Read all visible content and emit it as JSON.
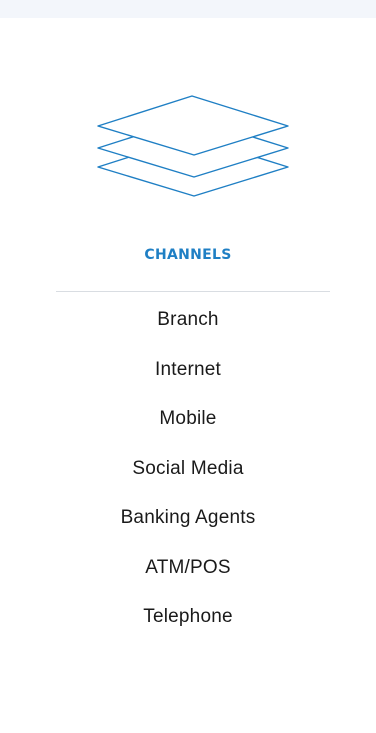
{
  "section": {
    "icon": "layers-icon",
    "accent_color": "#1f7fc4",
    "heading": "CHANNELS"
  },
  "channels": [
    {
      "label": "Branch"
    },
    {
      "label": "Internet"
    },
    {
      "label": "Mobile"
    },
    {
      "label": "Social Media"
    },
    {
      "label": "Banking Agents"
    },
    {
      "label": "ATM/POS"
    },
    {
      "label": "Telephone"
    }
  ]
}
